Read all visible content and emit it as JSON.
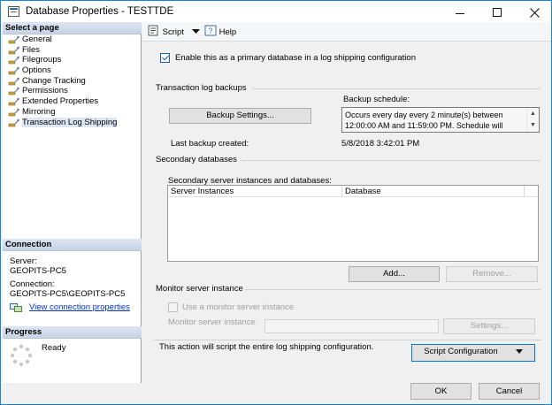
{
  "window": {
    "title": "Database Properties - TESTTDE"
  },
  "left": {
    "select_page_header": "Select a page",
    "pages": [
      {
        "label": "General"
      },
      {
        "label": "Files"
      },
      {
        "label": "Filegroups"
      },
      {
        "label": "Options"
      },
      {
        "label": "Change Tracking"
      },
      {
        "label": "Permissions"
      },
      {
        "label": "Extended Properties"
      },
      {
        "label": "Mirroring"
      },
      {
        "label": "Transaction Log Shipping",
        "selected": true
      }
    ],
    "connection_header": "Connection",
    "server_label": "Server:",
    "server_value": "GEOPITS-PC5",
    "connection_label": "Connection:",
    "connection_value": "GEOPITS-PC5\\GEOPITS-PC5",
    "view_connection_link": "View connection properties",
    "progress_header": "Progress",
    "progress_status": "Ready"
  },
  "toolbar": {
    "script_label": "Script",
    "help_label": "Help"
  },
  "main": {
    "enable_primary_label": "Enable this as a primary database in a log shipping configuration",
    "enable_primary_checked": true,
    "tlog_group_label": "Transaction log backups",
    "backup_schedule_label": "Backup schedule:",
    "backup_settings_button": "Backup Settings...",
    "backup_schedule_text": "Occurs every day every 2 minute(s) between 12:00:00 AM and 11:59:00 PM. Schedule will",
    "last_backup_label": "Last backup created:",
    "last_backup_value": "5/8/2018 3:42:01 PM",
    "secondary_group_label": "Secondary databases",
    "secondary_list_label": "Secondary server instances and databases:",
    "grid_columns": [
      "Server Instances",
      "Database"
    ],
    "add_button": "Add...",
    "remove_button": "Remove...",
    "monitor_group_label": "Monitor server instance",
    "use_monitor_label": "Use a monitor server instance",
    "monitor_instance_label": "Monitor server instance",
    "monitor_settings_button": "Settings...",
    "script_info_text": "This action will script the entire log shipping configuration.",
    "script_config_button": "Script Configuration"
  },
  "footer": {
    "ok_button": "OK",
    "cancel_button": "Cancel"
  },
  "colors": {
    "accent": "#0078d7",
    "link": "#0033cc",
    "header_gradient_top": "#dde6f3"
  }
}
